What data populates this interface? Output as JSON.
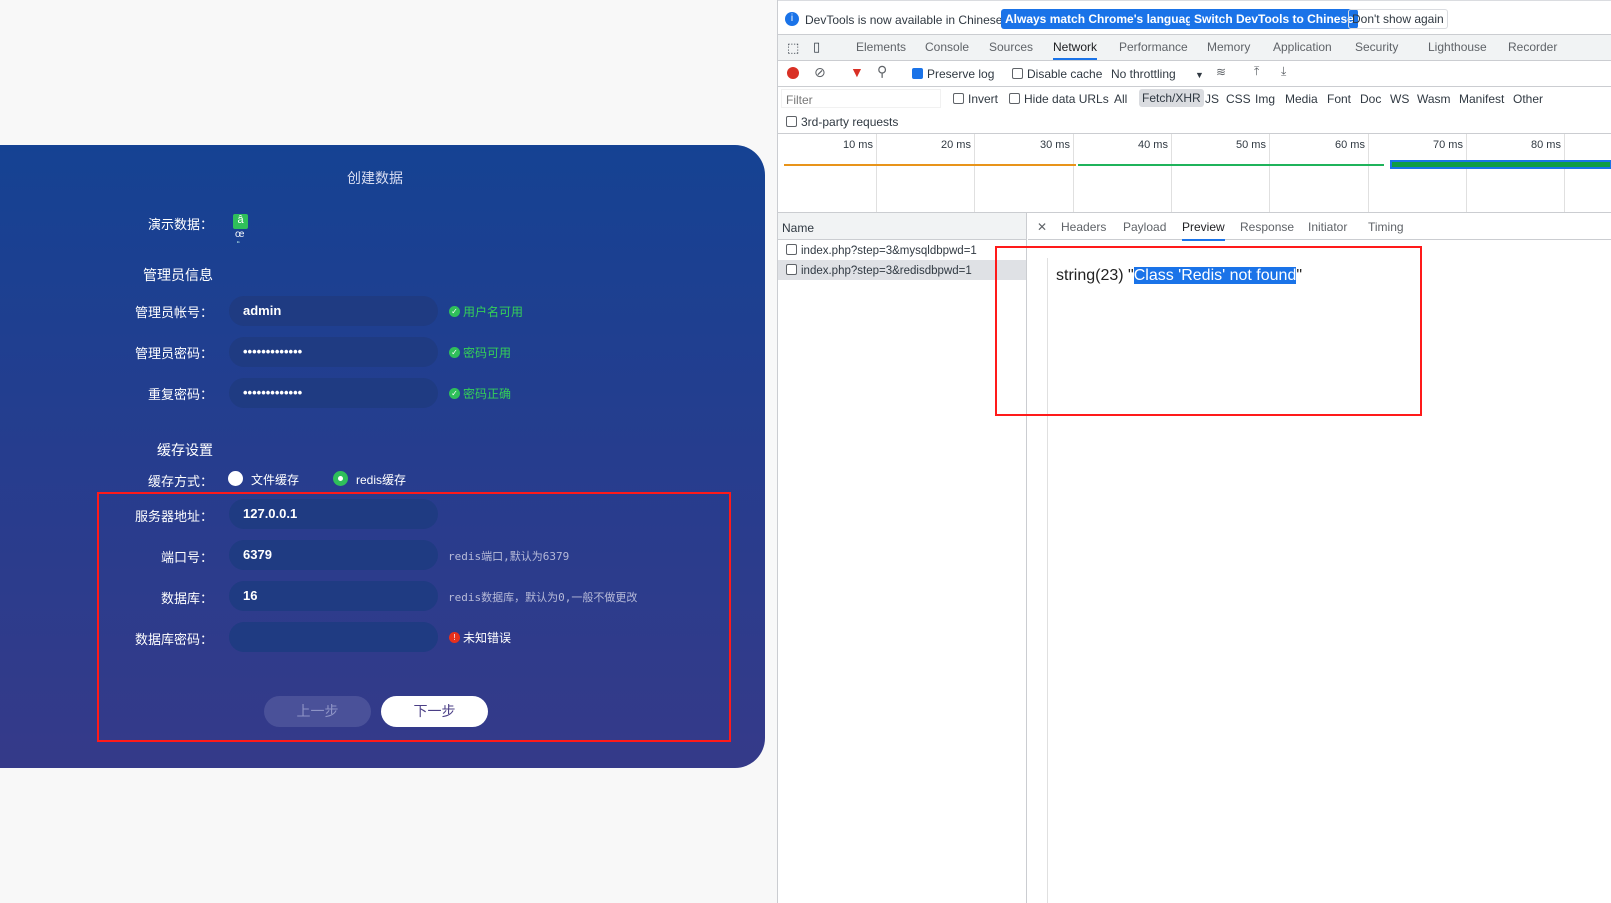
{
  "form": {
    "title": "创建数据",
    "demo_label": "演示数据：",
    "demo_glyphs": [
      "â",
      "œ",
      "“"
    ],
    "admin_section": "管理员信息",
    "admin_user_label": "管理员帐号：",
    "admin_user_value": "admin",
    "admin_user_status": "用户名可用",
    "admin_pwd_label": "管理员密码：",
    "admin_pwd_value": "•••••••••••••",
    "admin_pwd_status": "密码可用",
    "repeat_pwd_label": "重复密码：",
    "repeat_pwd_value": "•••••••••••••",
    "repeat_pwd_status": "密码正确",
    "cache_section": "缓存设置",
    "cache_mode_label": "缓存方式：",
    "cache_opt_file": "文件缓存",
    "cache_opt_redis": "redis缓存",
    "cache_selected": "redis",
    "server_label": "服务器地址：",
    "server_value": "127.0.0.1",
    "port_label": "端口号：",
    "port_value": "6379",
    "port_hint": "redis端口,默认为6379",
    "db_label": "数据库：",
    "db_value": "16",
    "db_hint": "redis数据库，默认为0,一般不做更改",
    "dbpwd_label": "数据库密码：",
    "dbpwd_value": "",
    "dbpwd_error": "未知错误",
    "prev_button": "上一步",
    "next_button": "下一步",
    "status_green": "#34d058",
    "error_red": "#e8301c"
  },
  "devtools": {
    "infobar": {
      "text": "DevTools is now available in Chinese!",
      "btn1": "Always match Chrome's language",
      "btn2": "Switch DevTools to Chinese",
      "btn3": "Don't show again"
    },
    "tabs": [
      "Elements",
      "Console",
      "Sources",
      "Network",
      "Performance",
      "Memory",
      "Application",
      "Security",
      "Lighthouse",
      "Recorder"
    ],
    "active_tab": "Network",
    "toolbar": {
      "preserve_log": "Preserve log",
      "disable_cache": "Disable cache",
      "throttling": "No throttling"
    },
    "filter": {
      "placeholder": "Filter",
      "invert": "Invert",
      "hide_data_urls": "Hide data URLs",
      "types": [
        "All",
        "Fetch/XHR",
        "JS",
        "CSS",
        "Img",
        "Media",
        "Font",
        "Doc",
        "WS",
        "Wasm",
        "Manifest",
        "Other"
      ],
      "active_type": "Fetch/XHR",
      "third_party": "3rd-party requests"
    },
    "timeline_ticks": [
      "10 ms",
      "20 ms",
      "30 ms",
      "40 ms",
      "50 ms",
      "60 ms",
      "70 ms",
      "80 ms"
    ],
    "name_header": "Name",
    "requests": [
      "index.php?step=3&mysqldbpwd=1",
      "index.php?step=3&redisdbpwd=1"
    ],
    "detail_tabs": [
      "Headers",
      "Payload",
      "Preview",
      "Response",
      "Initiator",
      "Timing"
    ],
    "active_detail_tab": "Preview",
    "preview": {
      "prefix": "string(23) \"",
      "selected": "Class 'Redis' not found",
      "suffix": "\""
    }
  }
}
